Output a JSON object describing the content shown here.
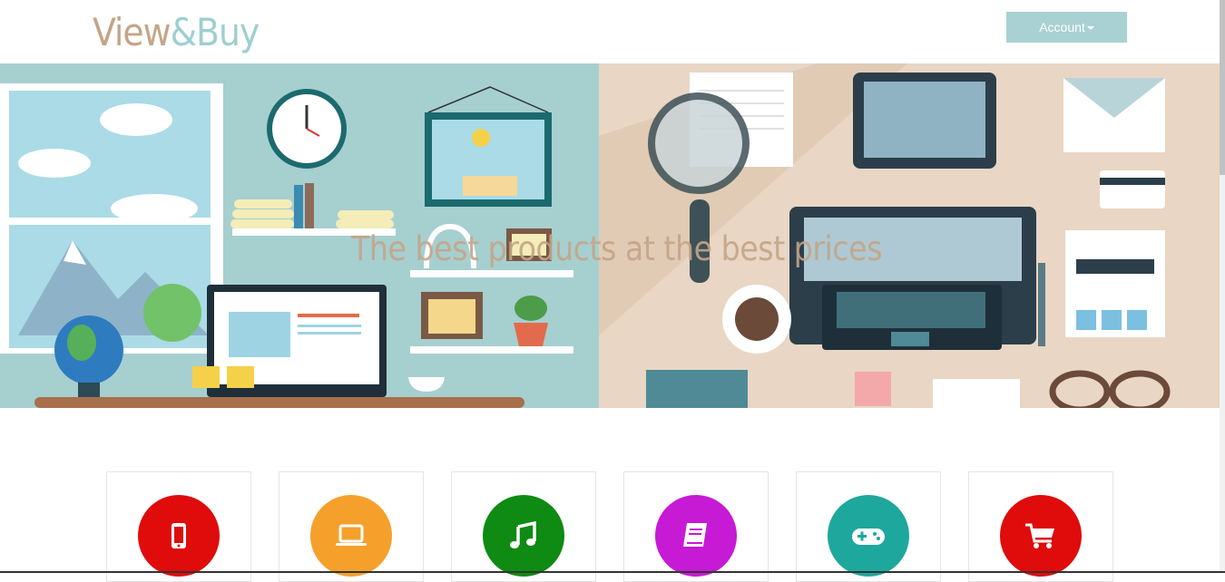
{
  "header": {
    "logo_part1": "View",
    "logo_part2": "&Buy",
    "account_label": "Account"
  },
  "hero": {
    "tagline": "The best products at the best prices"
  },
  "categories": [
    {
      "icon": "mobile-phone-icon",
      "color": "#e00b0b"
    },
    {
      "icon": "laptop-icon",
      "color": "#f5a02b"
    },
    {
      "icon": "music-note-icon",
      "color": "#0f8a12"
    },
    {
      "icon": "book-icon",
      "color": "#c61ad4"
    },
    {
      "icon": "gamepad-icon",
      "color": "#1ea79c"
    },
    {
      "icon": "shopping-cart-icon",
      "color": "#e00b0b"
    }
  ],
  "colors": {
    "logo_tan": "#c4a588",
    "logo_teal": "#9fcfd1",
    "account_bg": "#a9d1d3",
    "hero_left_bg": "#a6cfd0",
    "hero_right_bg": "#e9d6c4"
  }
}
